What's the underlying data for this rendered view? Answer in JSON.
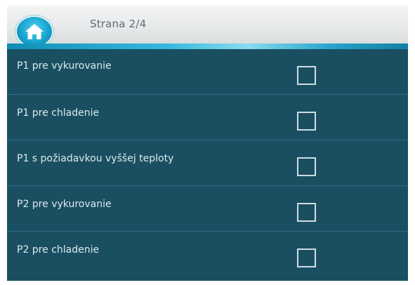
{
  "header": {
    "home_icon": "home-icon",
    "page_label": "Strana 2/4"
  },
  "options": [
    {
      "label": "P1 pre vykurovanie",
      "checked": false
    },
    {
      "label": "P1 pre chladenie",
      "checked": false
    },
    {
      "label": "P1 s požiadavkou vyššej teploty",
      "checked": false
    },
    {
      "label": "P2 pre vykurovanie",
      "checked": false
    },
    {
      "label": "P2 pre chladenie",
      "checked": false
    }
  ],
  "colors": {
    "background": "#1a4f61",
    "accent": "#35b9dc",
    "header": "#e7e9ea"
  }
}
